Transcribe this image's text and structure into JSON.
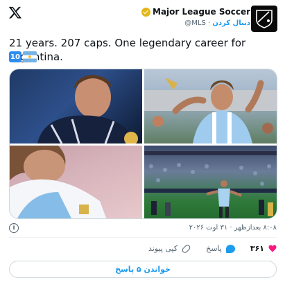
{
  "header": {
    "author_name": "Major League Soccer",
    "handle": "@MLS",
    "follow_label": "دنبال کردن",
    "avatar_text": "MLS"
  },
  "tweet": {
    "text": "21 years. 207 caps. One legendary career for Argentina.",
    "emoji_ten": "10"
  },
  "media": {
    "photos": [
      "photo-1",
      "photo-2",
      "photo-3",
      "photo-4"
    ]
  },
  "meta": {
    "time": "۸:۰۸ بعدازظهر · ۳۱ اوت ۲۰۲۶",
    "info_symbol": "i"
  },
  "actions": {
    "like_count": "۳۶۱",
    "reply_label": "پاسخ",
    "copy_link_label": "کپی پیوند"
  },
  "replies": {
    "button_label": "خواندن ۵ پاسخ"
  },
  "colors": {
    "accent": "#1d9bf0",
    "like": "#f91880",
    "verified": "#e2b719"
  }
}
